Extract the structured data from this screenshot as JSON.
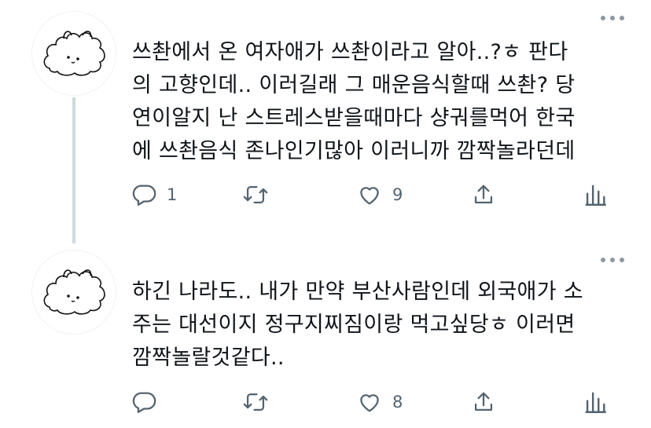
{
  "tweets": [
    {
      "text": "쓰촨에서 온 여자애가 쓰촨이라고 알아..?ㅎ 판다\n의 고향인데.. 이러길래 그 매운음식할때 쓰촨? 당\n연이알지 난 스트레스받을때마다 샹궈를먹어 한국\n에 쓰촨음식 존나인기많아 이러니까 깜짝놀라던데",
      "replies": "1",
      "retweets": "",
      "likes": "9",
      "icons": [
        "reply-icon",
        "retweet-icon",
        "like-icon",
        "share-icon",
        "analytics-icon"
      ]
    },
    {
      "text": "하긴 나라도.. 내가 만약 부산사람인데 외국애가 소\n주는 대선이지 정구지찌짐이랑 먹고싶당ㅎ 이러면\n깜짝놀랄것같다..",
      "replies": "",
      "retweets": "",
      "likes": "8",
      "icons": [
        "reply-icon",
        "retweet-icon",
        "like-icon",
        "share-icon",
        "analytics-icon"
      ]
    }
  ],
  "colors": {
    "icon": "#536471",
    "more": "#8b98a5",
    "thread_line": "#cfd9de",
    "text": "#0f1419"
  }
}
